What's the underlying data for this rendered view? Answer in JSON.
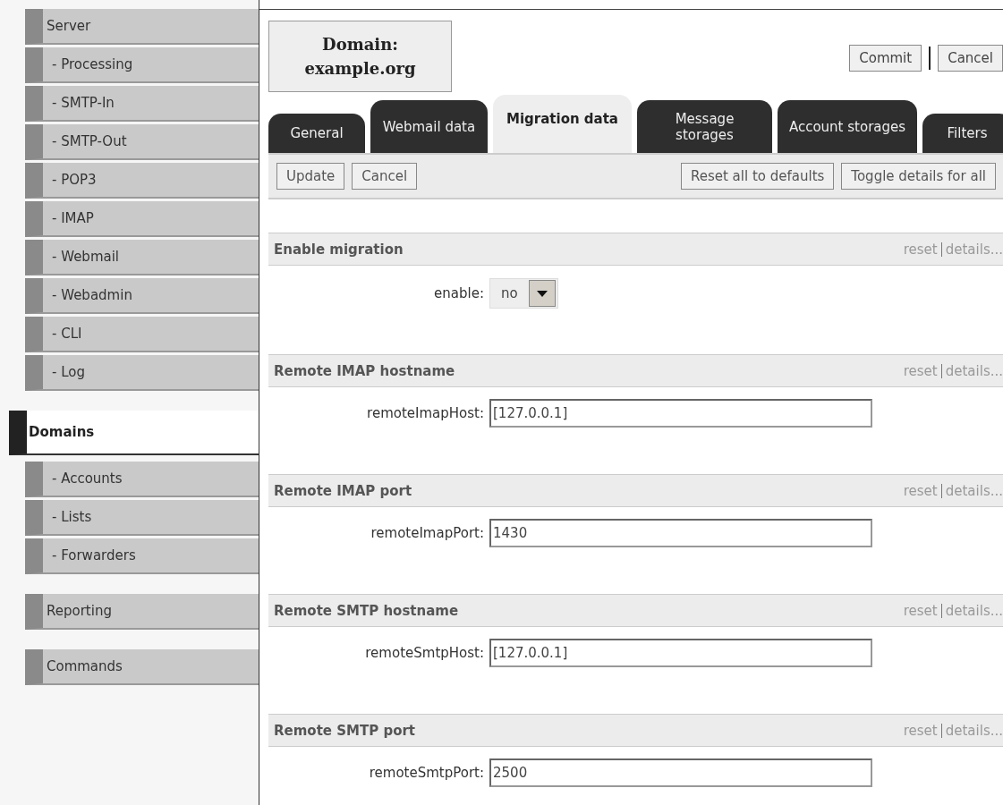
{
  "sidebar": {
    "items": [
      {
        "label": "Server",
        "selected": false,
        "children": [
          {
            "label": "- Processing",
            "selected": false
          },
          {
            "label": "- SMTP-In",
            "selected": false
          },
          {
            "label": "- SMTP-Out",
            "selected": false
          },
          {
            "label": "- POP3",
            "selected": false
          },
          {
            "label": "- IMAP",
            "selected": false
          },
          {
            "label": "- Webmail",
            "selected": false
          },
          {
            "label": "- Webadmin",
            "selected": false
          },
          {
            "label": "- CLI",
            "selected": false
          },
          {
            "label": "- Log",
            "selected": false
          }
        ]
      },
      {
        "label": "Domains",
        "selected": true,
        "children": [
          {
            "label": "- Accounts",
            "selected": false
          },
          {
            "label": "- Lists",
            "selected": false
          },
          {
            "label": "- Forwarders",
            "selected": false
          }
        ]
      },
      {
        "label": "Reporting",
        "selected": false
      },
      {
        "label": "Commands",
        "selected": false
      }
    ]
  },
  "header": {
    "title": "Domain:",
    "subtitle": "example.org",
    "buttons": [
      "Commit",
      "Cancel"
    ]
  },
  "tabs": [
    {
      "label": "General",
      "selected": false
    },
    {
      "label": "Webmail data",
      "selected": false
    },
    {
      "label": "Migration data",
      "selected": true
    },
    {
      "label": "Message storages",
      "selected": false
    },
    {
      "label": "Account storages",
      "selected": false
    },
    {
      "label": "Filters",
      "selected": false
    }
  ],
  "toolbar": {
    "left": [
      "Update",
      "Cancel"
    ],
    "right": [
      "Reset all to defaults",
      "Toggle details for all"
    ]
  },
  "sections": [
    {
      "title": "Enable migration",
      "reset": "reset",
      "details": "details...",
      "label": "enable:",
      "kind": "select",
      "value": "no"
    },
    {
      "title": "Remote IMAP hostname",
      "reset": "reset",
      "details": "details...",
      "label": "remoteImapHost:",
      "kind": "text",
      "value": "[127.0.0.1]"
    },
    {
      "title": "Remote IMAP port",
      "reset": "reset",
      "details": "details...",
      "label": "remoteImapPort:",
      "kind": "text",
      "value": "1430"
    },
    {
      "title": "Remote SMTP hostname",
      "reset": "reset",
      "details": "details...",
      "label": "remoteSmtpHost:",
      "kind": "text",
      "value": "[127.0.0.1]"
    },
    {
      "title": "Remote SMTP port",
      "reset": "reset",
      "details": "details...",
      "label": "remoteSmtpPort:",
      "kind": "text",
      "value": "2500"
    }
  ]
}
